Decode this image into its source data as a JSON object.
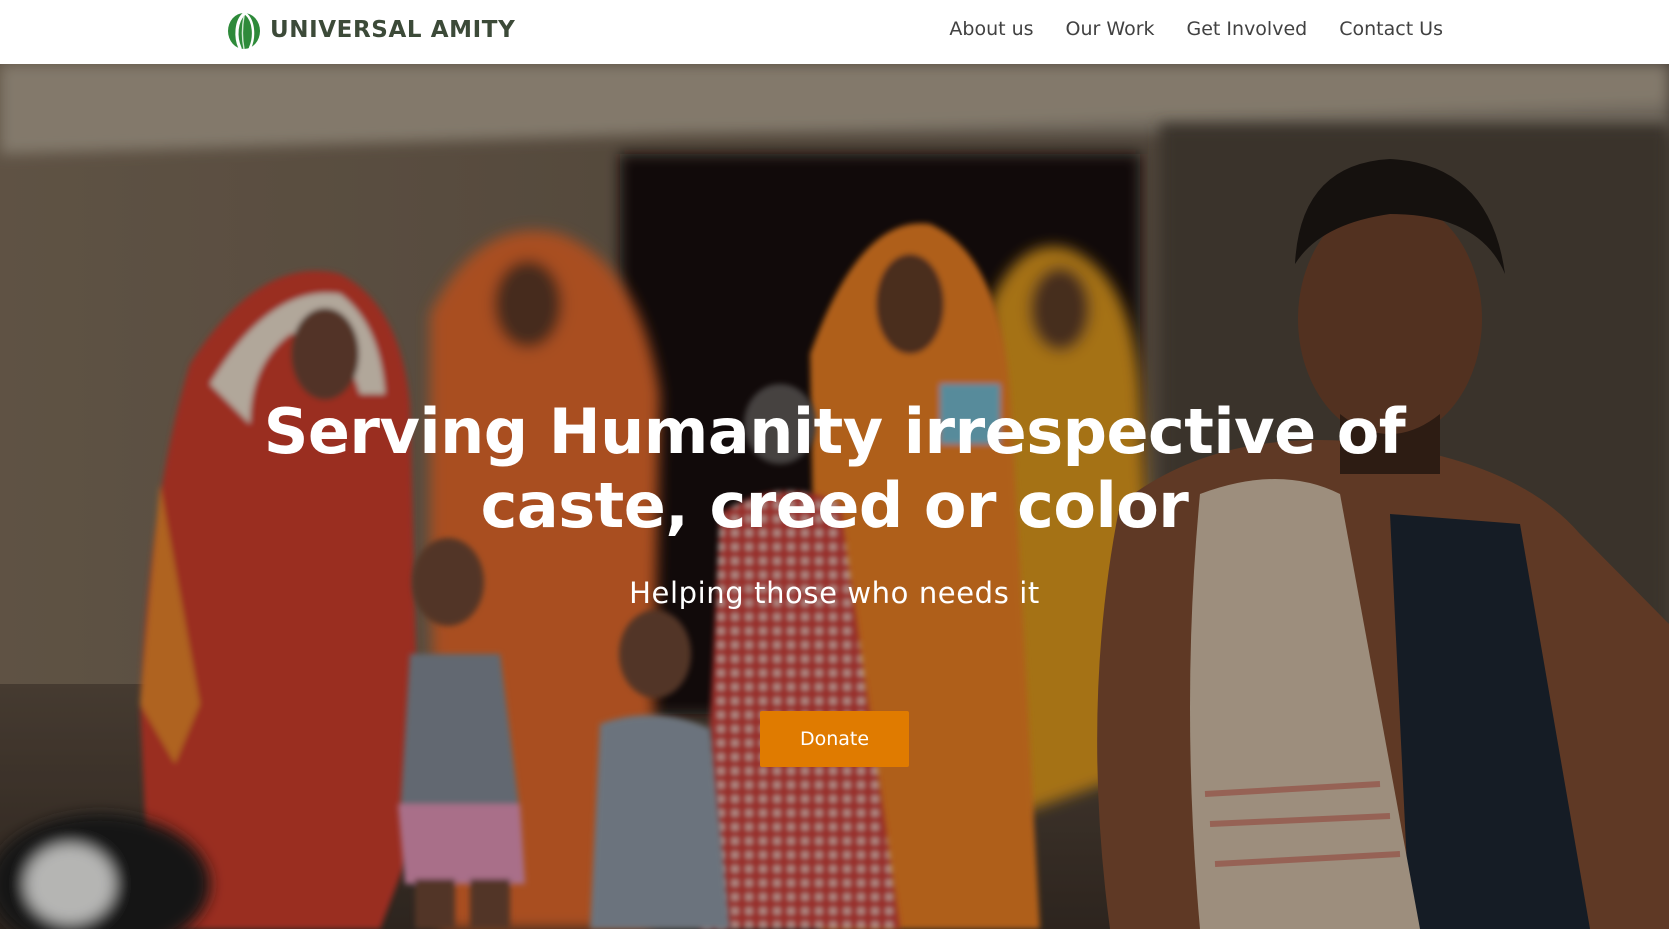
{
  "brand": {
    "name": "UNIVERSAL AMITY",
    "logo_icon": "leaf-logo-icon",
    "colors": {
      "name": "#3c4a38",
      "logo": "#2e8a3a"
    }
  },
  "nav": {
    "items": [
      {
        "label": "About us"
      },
      {
        "label": "Our Work"
      },
      {
        "label": "Get Involved"
      },
      {
        "label": "Contact Us"
      }
    ]
  },
  "hero": {
    "title_line1": "Serving Humanity irrespective of",
    "title_line2": "caste, creed or color",
    "subtitle": "Helping those who needs it",
    "cta_label": "Donate",
    "cta_color": "#e07b00"
  }
}
